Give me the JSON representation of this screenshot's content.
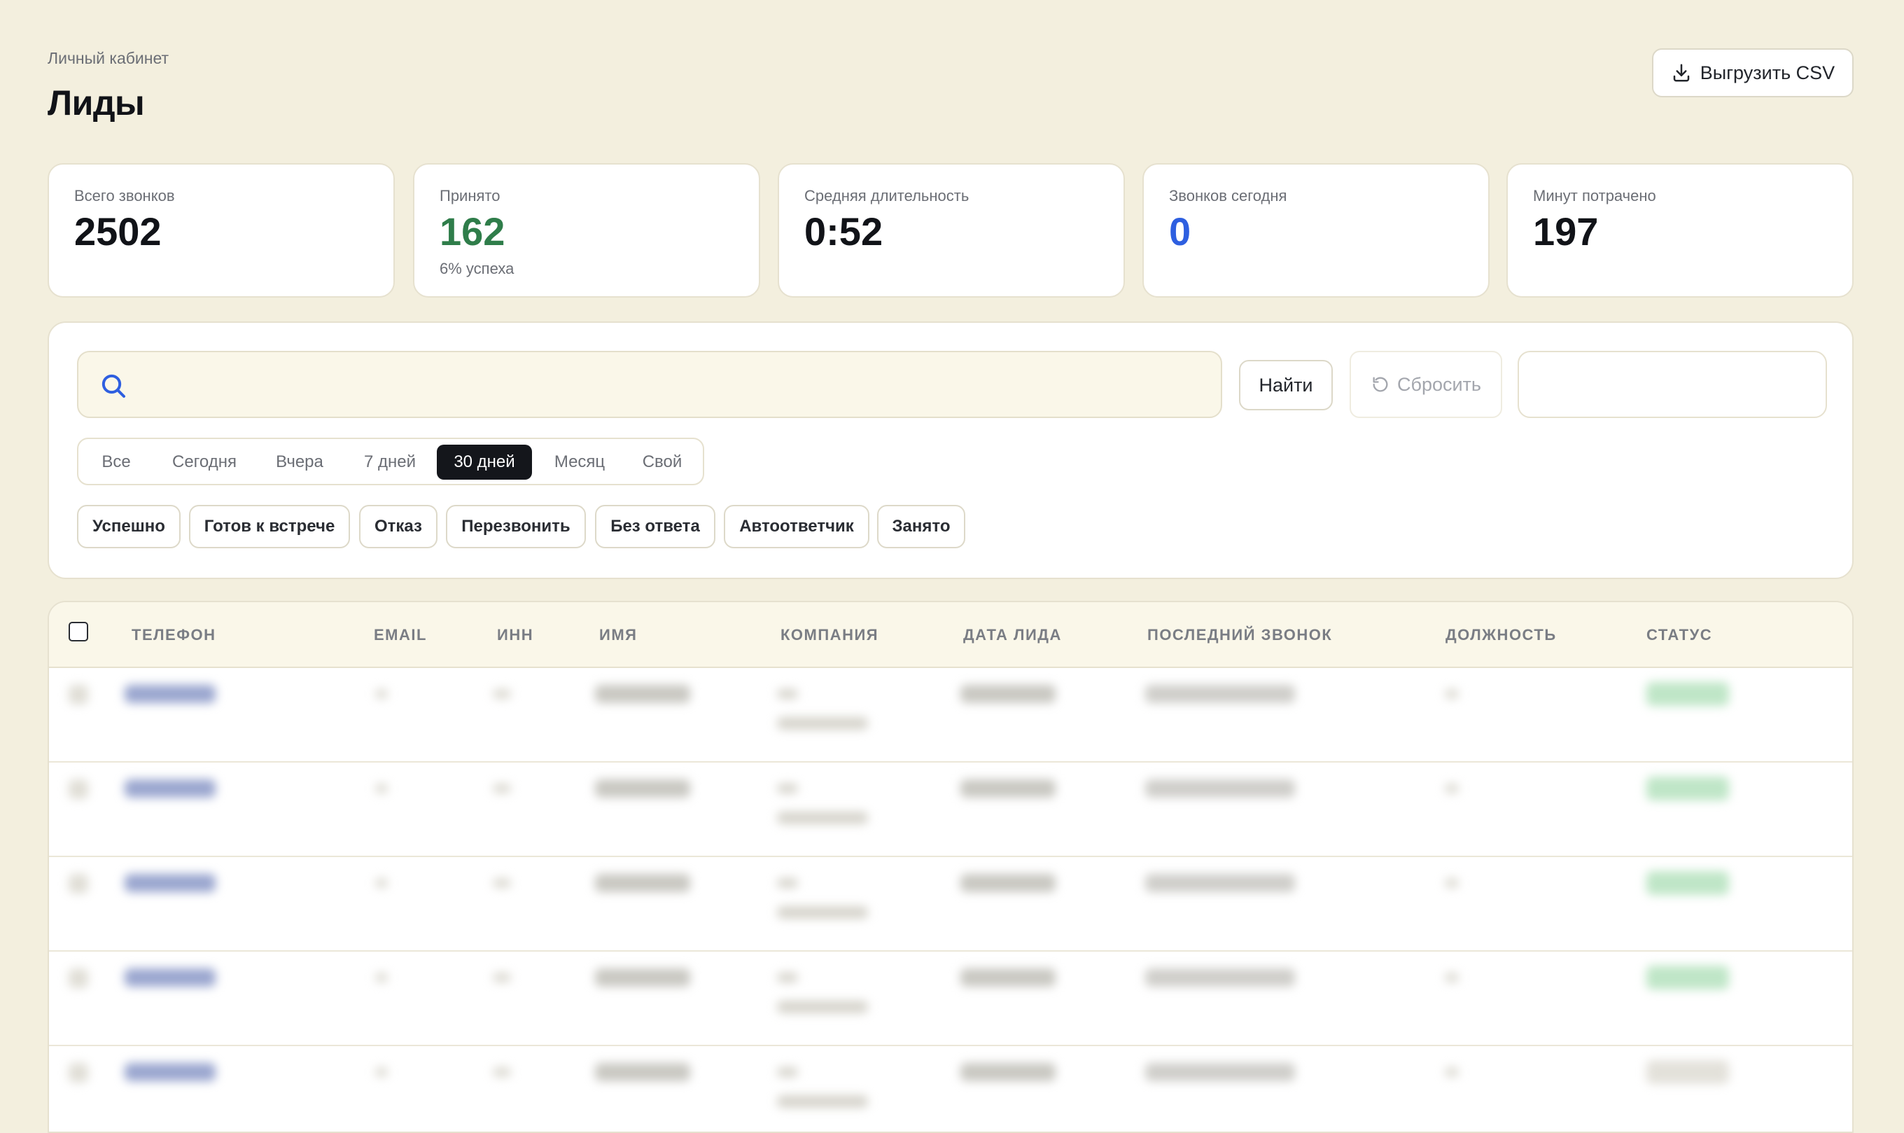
{
  "header": {
    "breadcrumb": "Личный кабинет",
    "title": "Лиды",
    "export_label": "Выгрузить CSV"
  },
  "stats": [
    {
      "label": "Всего звонков",
      "value": "2502",
      "sub": ""
    },
    {
      "label": "Принято",
      "value": "162",
      "sub": "6% успеха",
      "color": "#2f7d4a"
    },
    {
      "label": "Средняя длительность",
      "value": "0:52",
      "sub": ""
    },
    {
      "label": "Звонков сегодня",
      "value": "0",
      "sub": "",
      "color": "#2e5fe0"
    },
    {
      "label": "Минут потрачено",
      "value": "197",
      "sub": ""
    }
  ],
  "filters": {
    "search_value": "",
    "find_label": "Найти",
    "reset_label": "Сбросить",
    "date_range_value": "",
    "periods": [
      "Все",
      "Сегодня",
      "Вчера",
      "7 дней",
      "30 дней",
      "Месяц",
      "Свой"
    ],
    "active_period": "30 дней",
    "statuses": [
      "Успешно",
      "Готов к встрече",
      "Отказ",
      "Перезвонить",
      "Без ответа",
      "Автоответчик",
      "Занято"
    ]
  },
  "table": {
    "columns": [
      "ТЕЛЕФОН",
      "EMAIL",
      "ИНН",
      "ИМЯ",
      "КОМПАНИЯ",
      "ДАТА ЛИДА",
      "ПОСЛЕДНИЙ ЗВОНОК",
      "ДОЛЖНОСТЬ",
      "СТАТУС"
    ],
    "row_count_visible": 5,
    "rows_blurred": true
  },
  "colors": {
    "background": "#f3efde",
    "accent_dark": "#14161b",
    "success_green": "#2f7d4a",
    "link_blue": "#2e5fe0"
  },
  "icons": {
    "export": "download-icon",
    "search": "search-icon",
    "reset": "refresh-icon"
  }
}
